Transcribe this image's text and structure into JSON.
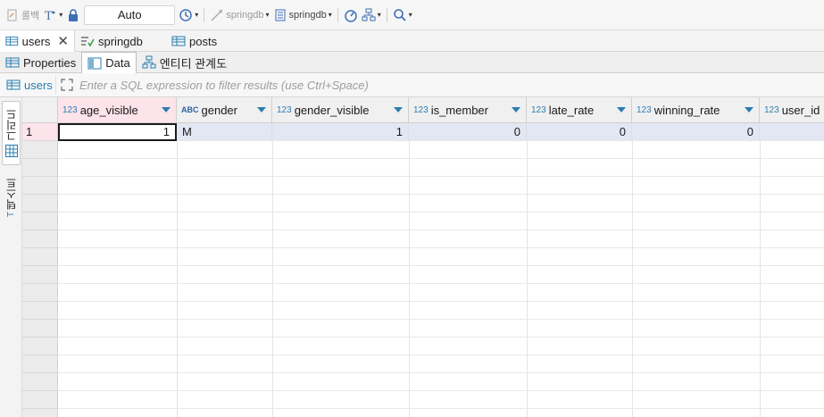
{
  "toolbar": {
    "rollback_label": "롤백",
    "transaction_mode": "Auto",
    "connection_label": "springdb",
    "schema_label": "springdb"
  },
  "editor_tabs": [
    {
      "label": "users",
      "active": true,
      "closable": true
    },
    {
      "label": "springdb",
      "active": false
    },
    {
      "label": "posts",
      "active": false
    }
  ],
  "sub_tabs": [
    {
      "label": "Properties",
      "active": false
    },
    {
      "label": "Data",
      "active": true
    },
    {
      "label": "엔티티 관계도",
      "active": false
    }
  ],
  "filter": {
    "entity": "users",
    "placeholder": "Enter a SQL expression to filter results (use Ctrl+Space)"
  },
  "side_tabs": {
    "grid": "그리드",
    "text": "텍스트"
  },
  "grid": {
    "columns": [
      {
        "name": "age_visible",
        "type": "123",
        "selected": true
      },
      {
        "name": "gender",
        "type": "ABC"
      },
      {
        "name": "gender_visible",
        "type": "123"
      },
      {
        "name": "is_member",
        "type": "123"
      },
      {
        "name": "late_rate",
        "type": "123"
      },
      {
        "name": "winning_rate",
        "type": "123"
      },
      {
        "name": "user_id",
        "type": "123"
      }
    ],
    "rows": [
      {
        "num": "1",
        "cells": [
          "1",
          "M",
          "1",
          "0",
          "0",
          "0",
          ""
        ]
      }
    ]
  },
  "colors": {
    "accent": "#2a7db0",
    "selected_header": "#fde3ea",
    "row_highlight": "#e3e6f3"
  }
}
